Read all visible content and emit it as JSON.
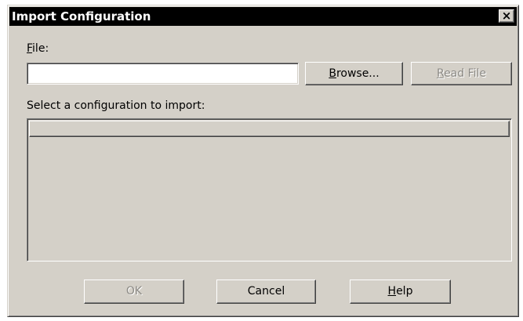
{
  "dialog": {
    "title": "Import Configuration",
    "close_label": "x"
  },
  "file": {
    "label_mnemonic": "F",
    "label_rest": "ile:",
    "input_value": "",
    "browse_mnemonic": "B",
    "browse_rest": "rowse...",
    "read_file_mnemonic": "R",
    "read_file_rest": "ead File"
  },
  "config_list": {
    "label": "Select a configuration to import:",
    "items": []
  },
  "buttons": {
    "ok_label": "OK",
    "cancel_label": "Cancel",
    "help_mnemonic": "H",
    "help_rest": "elp"
  },
  "colors": {
    "face": "#d4d0c8",
    "titlebar": "#000000",
    "disabled_text": "#8c8a85"
  }
}
